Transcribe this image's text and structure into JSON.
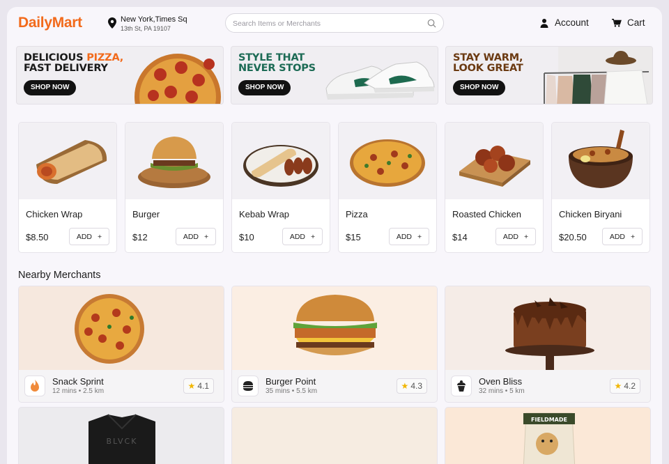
{
  "header": {
    "logo": "DailyMart",
    "location_line1": "New York,Times Sq",
    "location_line2": "13th St,  PA 19107",
    "search_placeholder": "Search Items or Merchants",
    "account_label": "Account",
    "cart_label": "Cart"
  },
  "banners": [
    {
      "line1_a": "DELICIOUS ",
      "line1_b": "PIZZA,",
      "line2": "FAST DELIVERY",
      "cta": "SHOP NOW",
      "accent": "#f26a1b",
      "ink": "#1b1b1b"
    },
    {
      "line1_a": "STYLE THAT",
      "line1_b": "",
      "line2": "NEVER STOPS",
      "cta": "SHOP NOW",
      "accent": "#1c6b55",
      "ink": "#1c6b55"
    },
    {
      "line1_a": "STAY WARM,",
      "line1_b": "",
      "line2": "LOOK GREAT",
      "cta": "SHOP NOW",
      "accent": "#6b3a12",
      "ink": "#6b3a12"
    }
  ],
  "food_items": [
    {
      "name": "Chicken Wrap",
      "price": "$8.50",
      "add_label": "ADD",
      "icon": "wrap-icon"
    },
    {
      "name": "Burger",
      "price": "$12",
      "add_label": "ADD",
      "icon": "burger-icon"
    },
    {
      "name": "Kebab Wrap",
      "price": "$10",
      "add_label": "ADD",
      "icon": "kebab-icon"
    },
    {
      "name": "Pizza",
      "price": "$15",
      "add_label": "ADD",
      "icon": "pizza-icon"
    },
    {
      "name": "Roasted Chicken",
      "price": "$14",
      "add_label": "ADD",
      "icon": "roasted-chicken-icon"
    },
    {
      "name": "Chicken Biryani",
      "price": "$20.50",
      "add_label": "ADD",
      "icon": "biryani-icon"
    }
  ],
  "nearby": {
    "title": "Nearby Merchants",
    "merchants": [
      {
        "name": "Snack Sprint",
        "meta": "12 mins • 2.5 km",
        "rating": "4.1",
        "bg": "#f6e8de"
      },
      {
        "name": "Burger Point",
        "meta": "35 mins • 5.5 km",
        "rating": "4.3",
        "bg": "#fbeee3"
      },
      {
        "name": "Oven Bliss",
        "meta": "32 mins • 5 km",
        "rating": "4.2",
        "bg": "#f5ece7"
      }
    ],
    "row2": [
      {
        "bg": "#ecebee",
        "brand": "BLVCK"
      },
      {
        "bg": "#f6ece1",
        "brand": ""
      },
      {
        "bg": "#fbe8d7",
        "brand": "FIELDMADE"
      }
    ]
  }
}
